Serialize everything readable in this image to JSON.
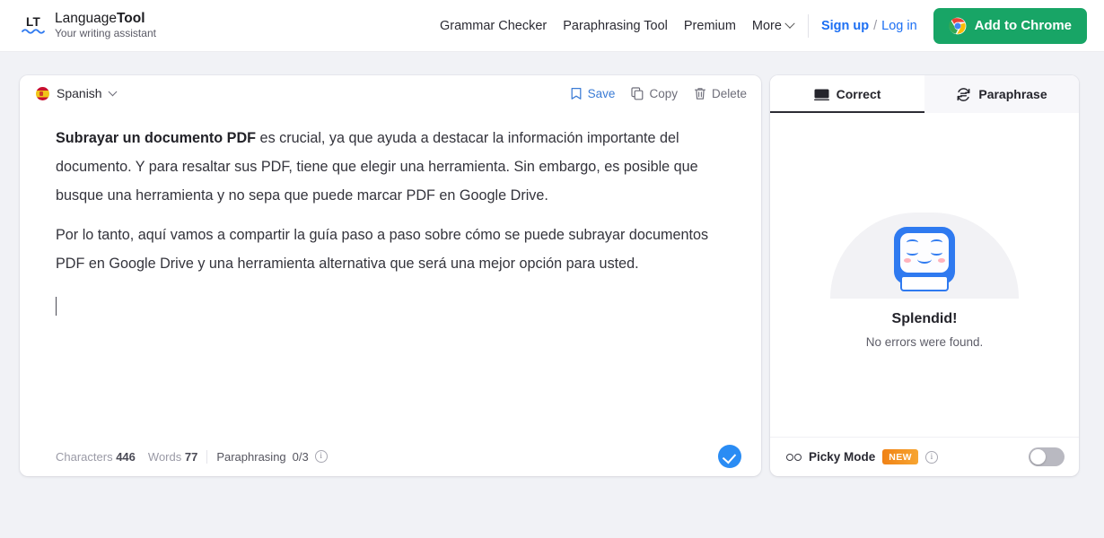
{
  "header": {
    "logo_mark": "LT",
    "brand_name_light": "Language",
    "brand_name_bold": "Tool",
    "tagline": "Your writing assistant",
    "nav": [
      {
        "label": "Grammar Checker"
      },
      {
        "label": "Paraphrasing Tool"
      },
      {
        "label": "Premium"
      },
      {
        "label": "More"
      }
    ],
    "auth": {
      "signup": "Sign up",
      "separator": "/",
      "login": "Log in"
    },
    "cta": {
      "label": "Add to Chrome",
      "icon": "chrome-icon",
      "color": "#18a566"
    }
  },
  "editor": {
    "language": {
      "name": "Spanish",
      "flag": "spain-flag-icon"
    },
    "actions": [
      {
        "label": "Save",
        "icon": "bookmark-icon",
        "color": "#3a7bd5"
      },
      {
        "label": "Copy",
        "icon": "copy-icon",
        "color": "#6d6d79"
      },
      {
        "label": "Delete",
        "icon": "trash-icon",
        "color": "#6d6d79"
      }
    ],
    "paragraph1_bold": "Subrayar un documento PDF",
    "paragraph1_rest": " es crucial, ya que ayuda a destacar la información importante del documento. Y para resaltar sus PDF, tiene que elegir una herramienta. Sin embargo, es posible que busque una herramienta y no sepa que puede marcar PDF en Google Drive.",
    "paragraph2": "Por lo tanto, aquí vamos a compartir la guía paso a paso sobre cómo se puede subrayar documentos PDF en Google Drive y una herramienta alternativa que será una mejor opción para usted.",
    "footer": {
      "characters_label": "Characters",
      "characters_value": "446",
      "words_label": "Words",
      "words_value": "77",
      "paraphrasing_label": "Paraphrasing",
      "paraphrasing_value": "0/3",
      "info_icon": "i",
      "check_button": "check-icon"
    }
  },
  "sidebar": {
    "tabs": [
      {
        "label": "Correct",
        "icon": "keyboard-icon",
        "active": true
      },
      {
        "label": "Paraphrase",
        "icon": "refresh-icon",
        "active": false
      }
    ],
    "result": {
      "mascot": "robot-mascot-happy",
      "title": "Splendid!",
      "subtitle": "No errors were found."
    },
    "footer": {
      "picky_icon": "glasses-icon",
      "picky_label": "Picky Mode",
      "new_badge": "NEW",
      "info_icon": "i",
      "toggle_state": "off"
    }
  }
}
